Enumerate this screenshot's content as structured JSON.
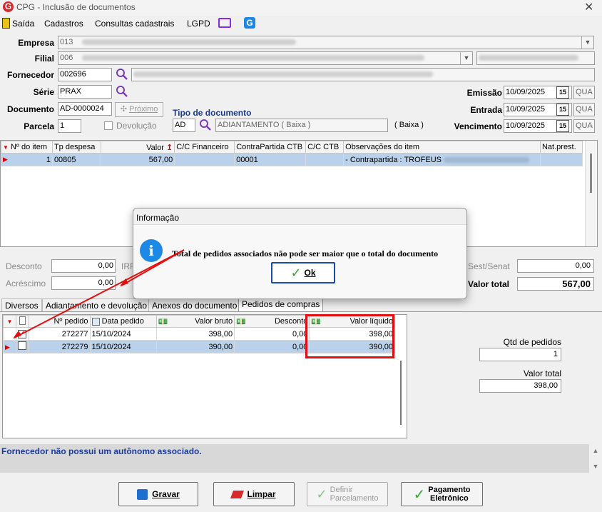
{
  "window": {
    "title": "CPG - Inclusão de documentos"
  },
  "menu": {
    "items": [
      "Saída",
      "Cadastros",
      "Consultas cadastrais",
      "LGPD"
    ]
  },
  "form": {
    "empresa_label": "Empresa",
    "empresa_value": "013",
    "filial_label": "Filial",
    "filial_value": "006",
    "fornecedor_label": "Fornecedor",
    "fornecedor_value": "002696",
    "serie_label": "Série",
    "serie_value": "PRAX",
    "documento_label": "Documento",
    "documento_value": "AD-0000024",
    "proximo_label": "Próximo",
    "parcela_label": "Parcela",
    "parcela_value": "1",
    "devolucao_label": "Devolução",
    "tipo_doc_label": "Tipo de documento",
    "tipo_doc_code": "AD",
    "tipo_doc_desc": "ADIANTAMENTO ( Baixa )",
    "tipo_doc_extra": "( Baixa )",
    "emissao_label": "Emissão",
    "emissao_value": "10/09/2025",
    "emissao_day": "QUA",
    "entrada_label": "Entrada",
    "entrada_value": "10/09/2025",
    "entrada_day": "QUA",
    "vencimento_label": "Vencimento",
    "vencimento_value": "10/09/2025",
    "vencimento_day": "QUA",
    "cal_label": "15"
  },
  "items_grid": {
    "headers": [
      "Nº do item",
      "Tp despesa",
      "Valor",
      "C/C Financeiro",
      "ContraPartida CTB",
      "C/C CTB",
      "Observações do item",
      "Nat.prest."
    ],
    "rows": [
      {
        "num": "1",
        "tp": "00805",
        "valor": "567,00",
        "ccf": "",
        "contra": "00001",
        "ccctb": "",
        "obs": "- Contrapartida : TROFEUS",
        "nat": ""
      }
    ]
  },
  "totals": {
    "desconto_label": "Desconto",
    "desconto_value": "0,00",
    "acrescimo_label": "Acréscimo",
    "acrescimo_value": "0,00",
    "irrf_label": "IRR",
    "sest_label": "Sest/Senat",
    "sest_value": "0,00",
    "valor_total_label": "Valor total",
    "valor_total_value": "567,00"
  },
  "tabs": [
    "Diversos",
    "Adiantamento e devolução",
    "Anexos do documento",
    "Pedidos de compras"
  ],
  "pedidos_grid": {
    "headers": [
      "Nº pedido",
      "Data pedido",
      "Valor bruto",
      "Desconto",
      "Valor líquido"
    ],
    "rows": [
      {
        "pedido": "272277",
        "data": "15/10/2024",
        "bruto": "398,00",
        "desconto": "0,00",
        "liquido": "398,00",
        "checked": true
      },
      {
        "pedido": "272279",
        "data": "15/10/2024",
        "bruto": "390,00",
        "desconto": "0,00",
        "liquido": "390,00",
        "checked": false
      }
    ]
  },
  "summary": {
    "qtd_label": "Qtd de pedidos",
    "qtd_value": "1",
    "total_label": "Valor total",
    "total_value": "398,00"
  },
  "status": {
    "message": "Fornecedor não possui um autônomo associado."
  },
  "buttons": {
    "gravar": "Gravar",
    "limpar": "Limpar",
    "definir_1": "Definir",
    "definir_2": "Parcelamento",
    "pagamento_1": "Pagamento",
    "pagamento_2": "Eletrônico"
  },
  "dialog": {
    "title": "Informação",
    "message": "Total de pedidos associados não pode ser maior que o total do documento",
    "ok": "Ok"
  }
}
